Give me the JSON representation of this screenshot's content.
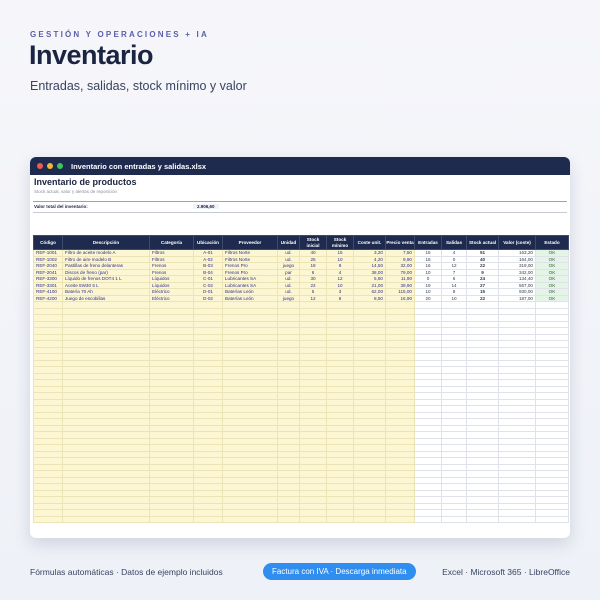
{
  "header": {
    "kicker": "GESTIÓN Y OPERACIONES + IA",
    "title": "Inventario",
    "subtitle": "Entradas, salidas, stock mínimo y valor"
  },
  "window": {
    "filename": "Inventario con entradas y salidas.xlsx"
  },
  "sheet": {
    "title": "Inventario de productos",
    "description": "Stock actual, valor y alertas de reposición",
    "total_label": "Valor total del inventario:",
    "total_value": "2.906,60",
    "columns": [
      "Código",
      "Descripción",
      "Categoría",
      "Ubicación",
      "Proveedor",
      "Unidad",
      "Stock inicial",
      "Stock mínimo",
      "Coste unit.",
      "Precio venta",
      "Entradas",
      "Salidas",
      "Stock actual",
      "Valor (coste)",
      "Estado"
    ],
    "rows": [
      [
        "REF-1001",
        "Filtro de aceite modelo A",
        "Filtros",
        "A-01",
        "Filtros Norte",
        "ud.",
        "40",
        "15",
        "3,20",
        "7,50",
        "15",
        "4",
        "51",
        "163,20",
        "OK"
      ],
      [
        "REF-1002",
        "Filtro de aire modelo B",
        "Filtros",
        "A-02",
        "Filtros Norte",
        "ud.",
        "25",
        "10",
        "4,20",
        "9,90",
        "15",
        "0",
        "40",
        "164,00",
        "OK"
      ],
      [
        "REF-2040",
        "Pastillas de freno delanteras",
        "Frenos",
        "B-03",
        "Frenos Pro",
        "juego",
        "18",
        "8",
        "14,50",
        "32,00",
        "16",
        "12",
        "22",
        "319,00",
        "OK"
      ],
      [
        "REF-2041",
        "Discos de freno (par)",
        "Frenos",
        "B-04",
        "Frenos Pro",
        "par",
        "6",
        "4",
        "38,00",
        "79,00",
        "10",
        "7",
        "9",
        "342,00",
        "OK"
      ],
      [
        "REF-3300",
        "Líquido de frenos DOT4 1 L",
        "Líquidos",
        "C-01",
        "Lubricantes SA",
        "ud.",
        "30",
        "12",
        "5,60",
        "11,90",
        "0",
        "6",
        "24",
        "134,40",
        "OK"
      ],
      [
        "REF-3301",
        "Aceite 5W30 5 L",
        "Líquidos",
        "C-02",
        "Lubricantes SA",
        "ud.",
        "22",
        "10",
        "21,00",
        "39,90",
        "19",
        "14",
        "27",
        "567,00",
        "OK"
      ],
      [
        "REF-4100",
        "Batería 70 Ah",
        "Eléctrico",
        "D-01",
        "Baterías León",
        "ud.",
        "5",
        "3",
        "62,00",
        "115,00",
        "10",
        "9",
        "15",
        "930,00",
        "OK"
      ],
      [
        "REF-4200",
        "Juego de escobillas",
        "Eléctrico",
        "D-02",
        "Baterías León",
        "juego",
        "12",
        "6",
        "8,50",
        "16,90",
        "20",
        "10",
        "22",
        "187,00",
        "OK"
      ]
    ]
  },
  "footer": {
    "left": "Fórmulas automáticas · Datos de ejemplo incluidos",
    "pill": "Factura con IVA · Descarga inmediata",
    "right": "Excel · Microsoft 365 · LibreOffice"
  }
}
